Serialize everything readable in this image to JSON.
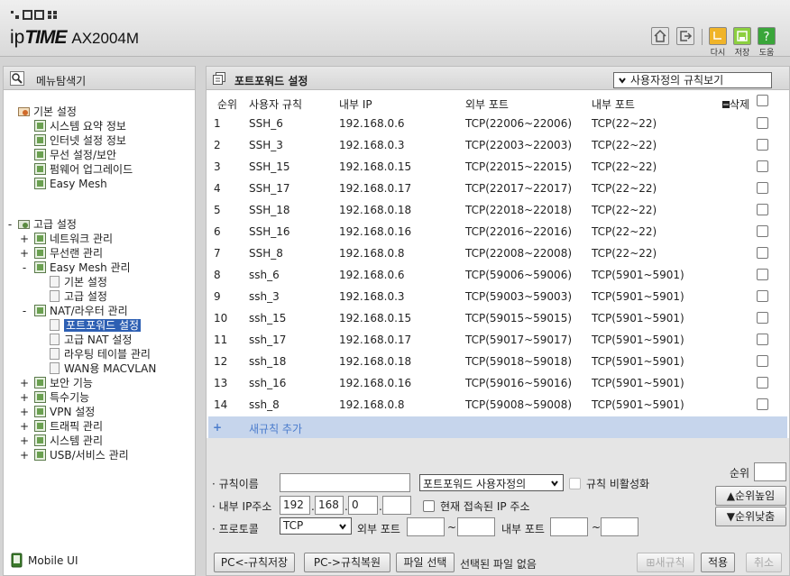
{
  "header": {
    "brand_prefix": "ip",
    "brand_main": "TIME",
    "model": "AX2004M",
    "buttons": [
      {
        "icon": "home-icon"
      },
      {
        "icon": "logout-icon"
      },
      {
        "icon": "refresh-icon",
        "label": "다시"
      },
      {
        "icon": "save-icon",
        "label": "저장"
      },
      {
        "icon": "help-icon",
        "label": "도움"
      }
    ]
  },
  "sidebar": {
    "title": "메뉴탐색기",
    "basic": {
      "label": "기본 설정",
      "items": [
        "시스템 요약 정보",
        "인터넷 설정 정보",
        "무선 설정/보안",
        "펌웨어 업그레이드",
        "Easy Mesh"
      ]
    },
    "advanced": {
      "label": "고급 설정",
      "items": [
        {
          "toggle": "+",
          "label": "네트워크 관리"
        },
        {
          "toggle": "+",
          "label": "무선랜 관리"
        },
        {
          "toggle": "-",
          "label": "Easy Mesh 관리"
        },
        {
          "toggle": "",
          "label": "기본 설정",
          "sub": true
        },
        {
          "toggle": "",
          "label": "고급 설정",
          "sub": true
        },
        {
          "toggle": "-",
          "label": "NAT/라우터 관리"
        },
        {
          "toggle": "",
          "label": "포트포워드 설정",
          "sub": true,
          "selected": true
        },
        {
          "toggle": "",
          "label": "고급 NAT 설정",
          "sub": true
        },
        {
          "toggle": "",
          "label": "라우팅 테이블 관리",
          "sub": true
        },
        {
          "toggle": "",
          "label": "WAN용 MACVLAN",
          "sub": true
        },
        {
          "toggle": "+",
          "label": "보안 기능"
        },
        {
          "toggle": "+",
          "label": "특수기능"
        },
        {
          "toggle": "+",
          "label": "VPN 설정"
        },
        {
          "toggle": "+",
          "label": "트래픽 관리"
        },
        {
          "toggle": "+",
          "label": "시스템 관리"
        },
        {
          "toggle": "+",
          "label": "USB/서비스 관리"
        }
      ]
    },
    "mobile_label": "Mobile UI"
  },
  "main": {
    "title": "포트포워드 설정",
    "view_select": "사용자정의 규칙보기",
    "columns": [
      "순위",
      "사용자 규칙",
      "내부 IP",
      "외부 포트",
      "내부 포트",
      "삭제"
    ],
    "rows": [
      {
        "no": "1",
        "name": "SSH_6",
        "ip": "192.168.0.6",
        "ext": "TCP(22006~22006)",
        "int": "TCP(22~22)"
      },
      {
        "no": "2",
        "name": "SSH_3",
        "ip": "192.168.0.3",
        "ext": "TCP(22003~22003)",
        "int": "TCP(22~22)"
      },
      {
        "no": "3",
        "name": "SSH_15",
        "ip": "192.168.0.15",
        "ext": "TCP(22015~22015)",
        "int": "TCP(22~22)"
      },
      {
        "no": "4",
        "name": "SSH_17",
        "ip": "192.168.0.17",
        "ext": "TCP(22017~22017)",
        "int": "TCP(22~22)"
      },
      {
        "no": "5",
        "name": "SSH_18",
        "ip": "192.168.0.18",
        "ext": "TCP(22018~22018)",
        "int": "TCP(22~22)"
      },
      {
        "no": "6",
        "name": "SSH_16",
        "ip": "192.168.0.16",
        "ext": "TCP(22016~22016)",
        "int": "TCP(22~22)"
      },
      {
        "no": "7",
        "name": "SSH_8",
        "ip": "192.168.0.8",
        "ext": "TCP(22008~22008)",
        "int": "TCP(22~22)"
      },
      {
        "no": "8",
        "name": "ssh_6",
        "ip": "192.168.0.6",
        "ext": "TCP(59006~59006)",
        "int": "TCP(5901~5901)"
      },
      {
        "no": "9",
        "name": "ssh_3",
        "ip": "192.168.0.3",
        "ext": "TCP(59003~59003)",
        "int": "TCP(5901~5901)"
      },
      {
        "no": "10",
        "name": "ssh_15",
        "ip": "192.168.0.15",
        "ext": "TCP(59015~59015)",
        "int": "TCP(5901~5901)"
      },
      {
        "no": "11",
        "name": "ssh_17",
        "ip": "192.168.0.17",
        "ext": "TCP(59017~59017)",
        "int": "TCP(5901~5901)"
      },
      {
        "no": "12",
        "name": "ssh_18",
        "ip": "192.168.0.18",
        "ext": "TCP(59018~59018)",
        "int": "TCP(5901~5901)"
      },
      {
        "no": "13",
        "name": "ssh_16",
        "ip": "192.168.0.16",
        "ext": "TCP(59016~59016)",
        "int": "TCP(5901~5901)"
      },
      {
        "no": "14",
        "name": "ssh_8",
        "ip": "192.168.0.8",
        "ext": "TCP(59008~59008)",
        "int": "TCP(5901~5901)"
      }
    ],
    "add_rule": "새규칙 추가",
    "form": {
      "rule_name_label": "규칙이름",
      "rule_name_value": "",
      "preset_select": "포트포워드 사용자정의",
      "disable_label": "규칙 비활성화",
      "priority_label": "순위",
      "priority_value": "",
      "ip_label": "내부 IP주소",
      "ip1": "192",
      "ip2": "168",
      "ip3": "0",
      "ip4": "",
      "current_ip_label": "현재 접속된 IP 주소",
      "protocol_label": "프로토콜",
      "protocol_value": "TCP",
      "ext_port_label": "외부 포트",
      "int_port_label": "내부 포트",
      "tilde": "~",
      "up_button": "순위높임",
      "down_button": "순위낮춤"
    },
    "footer": {
      "save_pc": "PC<-규칙저장",
      "restore_pc": "PC->규칙복원",
      "file_select": "파일 선택",
      "no_file": "선택된 파일 없음",
      "new_rule": "새규칙",
      "apply": "적용",
      "cancel": "취소"
    }
  },
  "colors": {
    "selected": "#2d5fb3",
    "add_row": "#c6d5ec",
    "add_text": "#4b7ccc",
    "help_green": "#3aa63a",
    "save_green": "#8ccf3f",
    "refresh_orange": "#f0b429"
  }
}
